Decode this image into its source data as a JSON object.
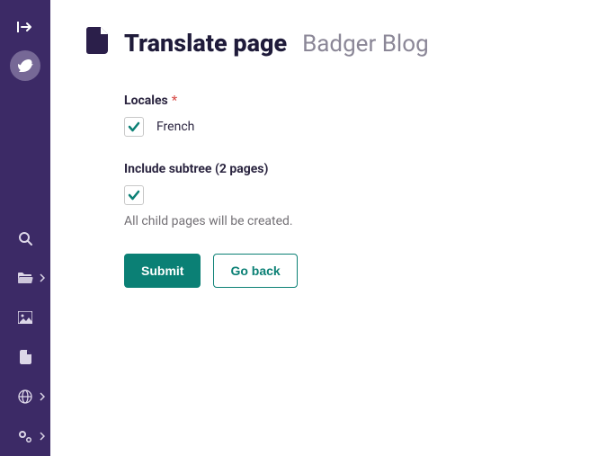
{
  "header": {
    "title": "Translate page",
    "subtitle": "Badger Blog"
  },
  "form": {
    "locales": {
      "label": "Locales",
      "required_marker": "*",
      "options": [
        {
          "label": "French",
          "checked": true
        }
      ]
    },
    "subtree": {
      "label": "Include subtree (2 pages)",
      "checked": true,
      "help": "All child pages will be created."
    },
    "submit_label": "Submit",
    "go_back_label": "Go back"
  },
  "sidebar": {
    "collapse_icon": "expand-icon",
    "avatar_icon": "bird-icon",
    "items": [
      {
        "name": "search",
        "icon": "search-icon",
        "has_submenu": false
      },
      {
        "name": "pages",
        "icon": "folder-open-icon",
        "has_submenu": true
      },
      {
        "name": "images",
        "icon": "image-icon",
        "has_submenu": false
      },
      {
        "name": "documents",
        "icon": "document-icon",
        "has_submenu": false
      },
      {
        "name": "snippets",
        "icon": "globe-icon",
        "has_submenu": true
      },
      {
        "name": "settings",
        "icon": "gears-icon",
        "has_submenu": true
      }
    ]
  }
}
